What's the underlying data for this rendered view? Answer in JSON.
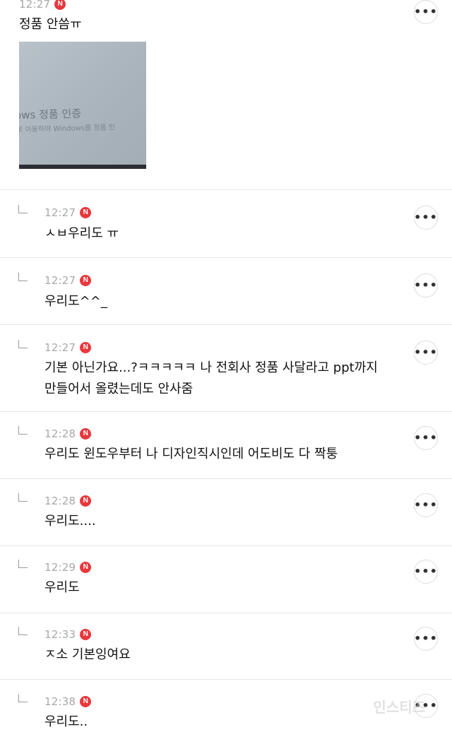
{
  "comments": [
    {
      "time": "12:27",
      "badge": "N",
      "text": "정품 안씀ㅠ",
      "more": "•••"
    },
    {
      "time": "12:27",
      "badge": "N",
      "text": "ㅅㅂ우리도 ㅠ",
      "more": "•••"
    },
    {
      "time": "12:27",
      "badge": "N",
      "text": "우리도^^_",
      "more": "•••"
    },
    {
      "time": "12:27",
      "badge": "N",
      "text_line1": "기본 아닌가요...?ㅋㅋㅋㅋㅋ 나 전회사 정품 사달라고 ppt까지",
      "text_line2": "만들어서 올렸는데도 안사줌",
      "more": "•••"
    },
    {
      "time": "12:28",
      "badge": "N",
      "text": "우리도 윈도우부터 나 디자인직시인데 어도비도 다 짝퉁",
      "more": "•••"
    },
    {
      "time": "12:28",
      "badge": "N",
      "text": "우리도....",
      "more": "•••"
    },
    {
      "time": "12:29",
      "badge": "N",
      "text": "우리도",
      "more": "•••"
    },
    {
      "time": "12:33",
      "badge": "N",
      "text": "ㅈ소 기본잉여요",
      "more": "•••"
    },
    {
      "time": "12:38",
      "badge": "N",
      "text": "우리도..",
      "more": "•••"
    }
  ],
  "attached_image": {
    "line1": "ows 정품 인증",
    "line2": "로 이동하여 Windows를 정품 인"
  },
  "watermark": "인스티즈",
  "colors": {
    "badge": "#e8383d",
    "time": "#a8a8a8",
    "divider": "#e6e6e6"
  }
}
